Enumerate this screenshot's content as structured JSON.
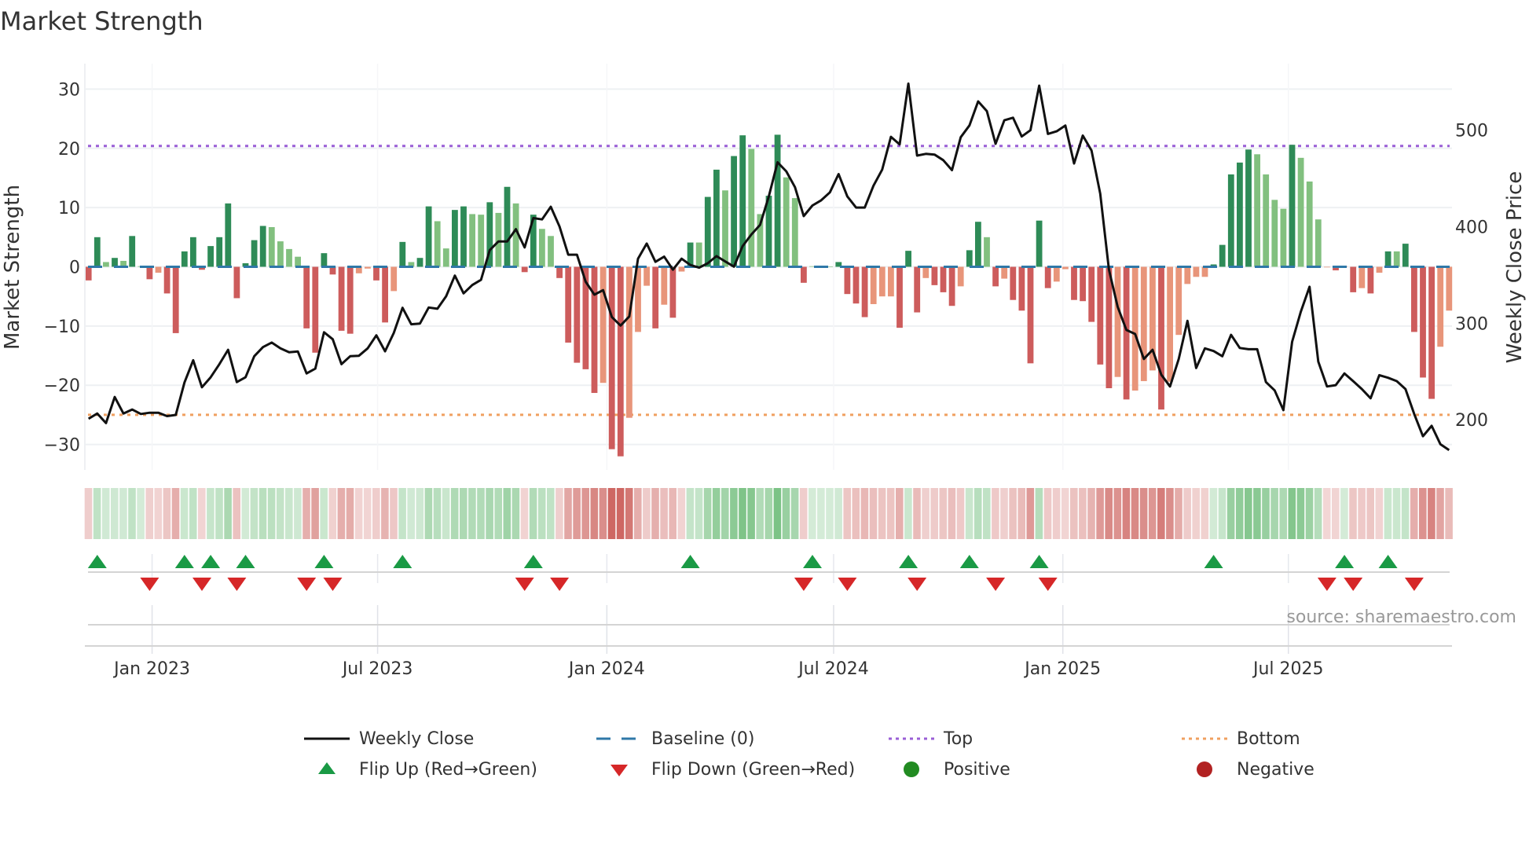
{
  "chart_data": {
    "type": "bar+line",
    "title": "Market Strength",
    "ylabel_left": "Market Strength",
    "ylabel_right": "Weekly Close Price",
    "source": "source: sharemaestro.com",
    "start_date": "2022-11-11",
    "interval_days": 7,
    "ylim_left": [
      -34.3,
      34.3
    ],
    "ylim_right": [
      148,
      569
    ],
    "yticks_left": [
      30,
      20,
      10,
      0,
      -10,
      -20,
      -30
    ],
    "yticks_left_labels": [
      "30",
      "20",
      "10",
      "0",
      "−10",
      "−20",
      "−30"
    ],
    "yticks_right": [
      500,
      400,
      300,
      200
    ],
    "yticks_right_labels": [
      "500",
      "400",
      "300",
      "200"
    ],
    "xticks": [
      {
        "date": "2023-01-01",
        "label": "Jan 2023"
      },
      {
        "date": "2023-07-01",
        "label": "Jul 2023"
      },
      {
        "date": "2024-01-01",
        "label": "Jan 2024"
      },
      {
        "date": "2024-07-01",
        "label": "Jul 2024"
      },
      {
        "date": "2025-01-01",
        "label": "Jan 2025"
      },
      {
        "date": "2025-07-01",
        "label": "Jul 2025"
      }
    ],
    "top_level": 20.4,
    "bottom_level": -25,
    "baseline": 0,
    "strength": [
      -2.3,
      5,
      0.8,
      1.5,
      1,
      5.2,
      0.1,
      -2.1,
      -1,
      -4.5,
      -11.2,
      2.6,
      5,
      -0.5,
      3.5,
      5,
      10.7,
      -5.3,
      0.6,
      4.5,
      6.9,
      6.7,
      4.3,
      3,
      1.7,
      -10.4,
      -14.5,
      2.3,
      -1.3,
      -10.8,
      -11.3,
      -1.1,
      -0.3,
      -2.3,
      -9.4,
      -4.1,
      4.2,
      0.8,
      1.5,
      10.2,
      7.7,
      3.1,
      9.6,
      10.2,
      8.9,
      8.8,
      10.9,
      9.1,
      13.5,
      10.7,
      -0.9,
      8.8,
      6.4,
      5.2,
      -1.9,
      -12.8,
      -16.2,
      -17.3,
      -21.3,
      -19.6,
      -30.8,
      -32,
      -25.5,
      -11,
      -3.2,
      -10.4,
      -6.4,
      -8.6,
      -0.8,
      4.1,
      4.1,
      11.8,
      16.4,
      12.9,
      18.7,
      22.2,
      19.9,
      8.9,
      12,
      22.3,
      15.1,
      11.6,
      -2.7,
      0.1,
      0.1,
      0.05,
      0.8,
      -4.6,
      -6.2,
      -8.5,
      -6.3,
      -5,
      -5,
      -10.3,
      2.7,
      -7.7,
      -1.9,
      -3.1,
      -4.3,
      -6.6,
      -3.3,
      2.8,
      7.6,
      5,
      -3.3,
      -2,
      -5.6,
      -7.4,
      -16.3,
      7.8,
      -3.6,
      -2.5,
      -0.4,
      -5.6,
      -5.8,
      -9.3,
      -16.5,
      -20.5,
      -18.6,
      -22.4,
      -20.9,
      -19.3,
      -17.5,
      -24.1,
      -19.4,
      -11.5,
      -2.9,
      -1.7,
      -1.7,
      0.4,
      3.7,
      15.6,
      17.6,
      19.8,
      19,
      15.6,
      11.3,
      9.8,
      20.6,
      18.4,
      14.4,
      8,
      -0.1,
      -0.6,
      0.1,
      -4.3,
      -3.6,
      -4.5,
      -1,
      2.6,
      2.6,
      3.9,
      -11,
      -18.7,
      -22.3,
      -13.5,
      -7.4
    ],
    "shade": "RGgGgGgRrRRGGRGGGRGGGggggRRGRRRrrRRrGgGGggGGggGgGgRGggRRRRRrRRrrrRrRrGgGGgGGggGGggRgGgGRRRrrrRGRrRRRrGGgRrRRRGRrrRRRRRrRrrrRrrrrrGGGGGggggGgggrRrRrRrGgGRRRrr",
    "shade_legend": {
      "G": "strong positive",
      "g": "weak positive",
      "R": "strong negative",
      "r": "weak negative"
    },
    "weekly_close": [
      201,
      206.5,
      196.5,
      223.6,
      206.5,
      210.6,
      206,
      207.3,
      207.3,
      203.8,
      205,
      238.6,
      261.7,
      233.7,
      244,
      257.6,
      272.5,
      239,
      244,
      265.8,
      275.3,
      280,
      274,
      270,
      270.7,
      248,
      253,
      290.7,
      283.4,
      257.6,
      265.8,
      266.3,
      274,
      287.5,
      271,
      290,
      316,
      299,
      299.7,
      316.3,
      315,
      328,
      349.4,
      331,
      339.6,
      345,
      375.8,
      384.8,
      384.8,
      397.5,
      378.5,
      409,
      407.6,
      420.7,
      400.3,
      371,
      371,
      343,
      329.6,
      334.3,
      306.5,
      297.6,
      307,
      366.9,
      382.6,
      363.6,
      369,
      355.5,
      366.9,
      360.4,
      357.6,
      362.2,
      369.6,
      364,
      358.7,
      380,
      392,
      402,
      431.5,
      466.8,
      457.4,
      441,
      411,
      422,
      427.4,
      435.6,
      454.6,
      431.5,
      419.9,
      419.9,
      442.5,
      459.2,
      493.2,
      485.3,
      548.3,
      473.7,
      475.5,
      474.8,
      469,
      458.7,
      492.7,
      504.9,
      529.9,
      519.8,
      485.9,
      510.3,
      513,
      493.5,
      500,
      546.2,
      496.2,
      498.9,
      504.9,
      465.5,
      494.5,
      479,
      434.2,
      355.5,
      317,
      293,
      288.9,
      263,
      272.5,
      246.7,
      234.5,
      263,
      302.5,
      253.6,
      274,
      271.2,
      265.8,
      288,
      274.4,
      273.1,
      273.1,
      239,
      230.4,
      210,
      280.7,
      312,
      337.8,
      260.3,
      234.5,
      235.9,
      248,
      240,
      231.8,
      222.3,
      246.2,
      243.5,
      240,
      231.8,
      206,
      182.9,
      193.7,
      174.7,
      168.5
    ],
    "flip_up_weeks": [
      1,
      11,
      14,
      18,
      27,
      36,
      51,
      69,
      83,
      94,
      101,
      109,
      129,
      144,
      149
    ],
    "flip_down_weeks": [
      7,
      13,
      17,
      25,
      28,
      50,
      54,
      82,
      87,
      95,
      104,
      110,
      142,
      145,
      152
    ],
    "legend": {
      "weekly_close": "Weekly Close",
      "baseline": "Baseline (0)",
      "top": "Top",
      "bottom": "Bottom",
      "flip_up": "Flip Up (Red→Green)",
      "flip_down": "Flip Down (Green→Red)",
      "positive": "Positive",
      "negative": "Negative"
    },
    "colors": {
      "dark_green": "#2e8b57",
      "light_green": "#82c07f",
      "red": "#cd5c5c",
      "salmon": "#e8957a",
      "price_line": "#111111",
      "baseline": "#2f78a8",
      "top": "#9a5fd6",
      "bottom": "#f0a060",
      "flip_up": "#1a9a45",
      "flip_down": "#d62728",
      "positive": "#228b22",
      "negative": "#b22222"
    }
  }
}
